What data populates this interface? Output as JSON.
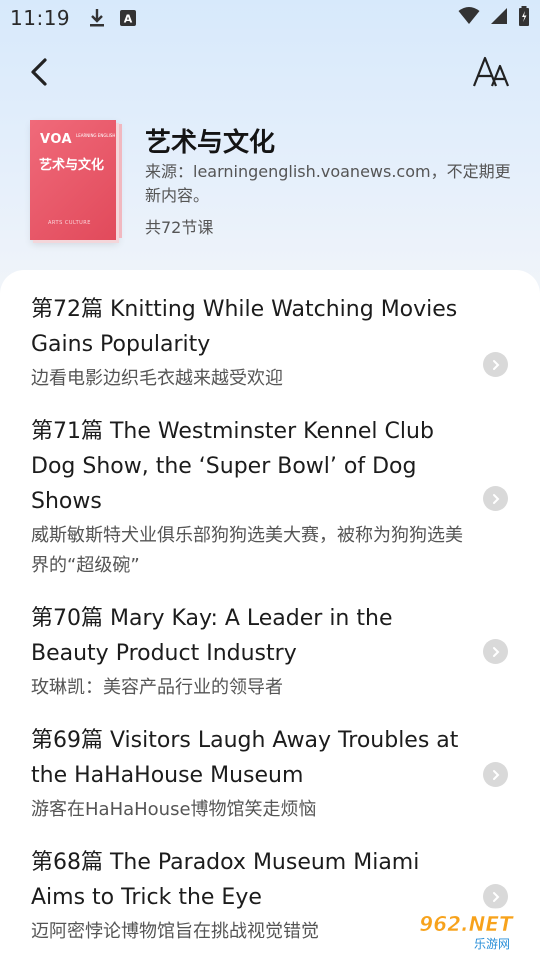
{
  "status_bar": {
    "time": "11:19",
    "icons": [
      "download-icon",
      "font-a-icon",
      "wifi-icon",
      "signal-icon",
      "battery-icon"
    ]
  },
  "top_bar": {
    "back_icon": "chevron-left-icon",
    "font_icon": "font-size-icon"
  },
  "course": {
    "cover_logo": "VOA",
    "cover_logo_small": "LEARNING ENGLISH",
    "cover_title": "艺术与文化",
    "cover_subtitle": "ARTS CULTURE",
    "title": "艺术与文化",
    "source": "来源：learningenglish.voanews.com，不定期更新内容。",
    "count": "共72节课"
  },
  "lessons": [
    {
      "title": "第72篇 Knitting While Watching Movies Gains Popularity",
      "subtitle": "边看电影边织毛衣越来越受欢迎"
    },
    {
      "title": "第71篇 The Westminster Kennel Club Dog Show, the ‘Super Bowl’ of Dog Shows",
      "subtitle": "威斯敏斯特犬业俱乐部狗狗选美大赛，被称为狗狗选美界的“超级碗”"
    },
    {
      "title": "第70篇 Mary Kay: A Leader in the Beauty Product Industry",
      "subtitle": "玫琳凯：美容产品行业的领导者"
    },
    {
      "title": "第69篇 Visitors Laugh Away Troubles at the HaHaHouse Museum",
      "subtitle": "游客在HaHaHouse博物馆笑走烦恼"
    },
    {
      "title": "第68篇 The Paradox Museum Miami Aims to Trick the Eye",
      "subtitle": "迈阿密悖论博物馆旨在挑战视觉错觉"
    }
  ],
  "watermark": {
    "logo": "962.NET",
    "text": "乐游网"
  },
  "colors": {
    "cover": "#e14a5b",
    "background_top": "#d7e9fb",
    "arrow": "#d9d9d9"
  }
}
